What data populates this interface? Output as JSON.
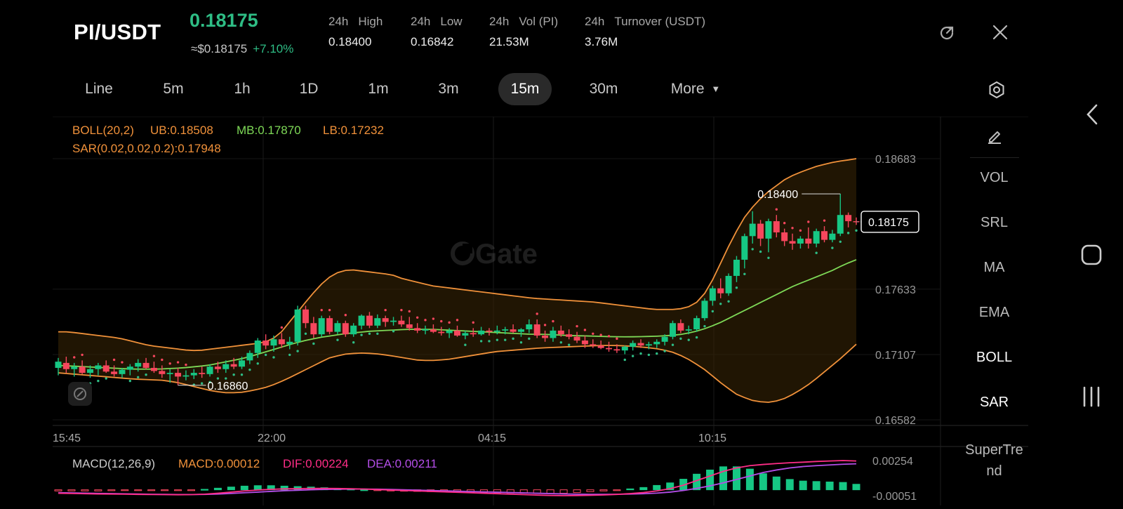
{
  "header": {
    "pair": "PI/USDT",
    "last_price": "0.18175",
    "approx_price": "≈$0.18175",
    "change": "+7.10%",
    "stats": [
      {
        "prefix": "24h",
        "label": "High",
        "value": "0.18400"
      },
      {
        "prefix": "24h",
        "label": "Low",
        "value": "0.16842"
      },
      {
        "prefix": "24h",
        "label": "Vol (PI)",
        "value": "21.53M"
      },
      {
        "prefix": "24h",
        "label": "Turnover (USDT)",
        "value": "3.76M"
      }
    ]
  },
  "timeframes": {
    "items": [
      "Line",
      "5m",
      "1h",
      "1D",
      "1m",
      "3m",
      "15m",
      "30m",
      "More"
    ],
    "active": "15m"
  },
  "indicators": {
    "boll": {
      "name": "BOLL(20,2)",
      "ub": "UB:0.18508",
      "mb": "MB:0.17870",
      "lb": "LB:0.17232"
    },
    "sar": {
      "text": "SAR(0.02,0.02,0.2):0.17948"
    },
    "macd": {
      "name": "MACD(12,26,9)",
      "macd": "MACD:0.00012",
      "dif": "DIF:0.00224",
      "dea": "DEA:0.00211"
    }
  },
  "side_panel": {
    "items": [
      "VOL",
      "SRL",
      "MA",
      "EMA",
      "BOLL",
      "SAR",
      "SuperTre",
      "nd"
    ],
    "active": [
      "BOLL",
      "SAR"
    ]
  },
  "chart_data": {
    "type": "candlestick",
    "y_ticks": [
      "0.18683",
      "0.17633",
      "0.17107",
      "0.16582"
    ],
    "x_ticks": [
      "15:45",
      "22:00",
      "04:15",
      "10:15"
    ],
    "current_price_label": "0.18175",
    "high_marker": "0.18400",
    "low_marker": "0.16860",
    "macd_ticks": [
      "0.00254",
      "-0.00051"
    ],
    "watermark": "Gate",
    "colors": {
      "up": "#16c784",
      "down": "#f6465d",
      "boll_band": "#f0913a",
      "boll_mid": "#7ed957",
      "dif": "#ff2d87",
      "dea": "#b44ee8",
      "sar_up": "#2ebd85",
      "sar_down": "#f6465d"
    },
    "candles": [
      {
        "o": 0.17,
        "h": 0.1708,
        "l": 0.1694,
        "c": 0.1705
      },
      {
        "o": 0.1704,
        "h": 0.1709,
        "l": 0.1696,
        "c": 0.1699
      },
      {
        "o": 0.1699,
        "h": 0.1704,
        "l": 0.1693,
        "c": 0.1701
      },
      {
        "o": 0.1701,
        "h": 0.1706,
        "l": 0.1695,
        "c": 0.1696
      },
      {
        "o": 0.1696,
        "h": 0.1702,
        "l": 0.1692,
        "c": 0.1699
      },
      {
        "o": 0.1699,
        "h": 0.1704,
        "l": 0.1694,
        "c": 0.1702
      },
      {
        "o": 0.1702,
        "h": 0.1706,
        "l": 0.1696,
        "c": 0.1697
      },
      {
        "o": 0.1697,
        "h": 0.1702,
        "l": 0.1693,
        "c": 0.1695
      },
      {
        "o": 0.1695,
        "h": 0.17,
        "l": 0.1692,
        "c": 0.16985
      },
      {
        "o": 0.16985,
        "h": 0.1703,
        "l": 0.1694,
        "c": 0.1701
      },
      {
        "o": 0.1701,
        "h": 0.1707,
        "l": 0.1697,
        "c": 0.1704
      },
      {
        "o": 0.1704,
        "h": 0.1708,
        "l": 0.1699,
        "c": 0.17
      },
      {
        "o": 0.17,
        "h": 0.1705,
        "l": 0.1696,
        "c": 0.16975
      },
      {
        "o": 0.16975,
        "h": 0.1702,
        "l": 0.1692,
        "c": 0.1695
      },
      {
        "o": 0.1695,
        "h": 0.1699,
        "l": 0.1688,
        "c": 0.1696
      },
      {
        "o": 0.1696,
        "h": 0.17,
        "l": 0.1686,
        "c": 0.1693
      },
      {
        "o": 0.1693,
        "h": 0.1698,
        "l": 0.169,
        "c": 0.1694
      },
      {
        "o": 0.1694,
        "h": 0.1699,
        "l": 0.1691,
        "c": 0.1696
      },
      {
        "o": 0.1696,
        "h": 0.1701,
        "l": 0.1692,
        "c": 0.1695
      },
      {
        "o": 0.1695,
        "h": 0.1703,
        "l": 0.1693,
        "c": 0.1701
      },
      {
        "o": 0.1701,
        "h": 0.1705,
        "l": 0.1696,
        "c": 0.1699
      },
      {
        "o": 0.1699,
        "h": 0.1706,
        "l": 0.1696,
        "c": 0.1703
      },
      {
        "o": 0.1703,
        "h": 0.1708,
        "l": 0.1699,
        "c": 0.1701
      },
      {
        "o": 0.1701,
        "h": 0.1709,
        "l": 0.1699,
        "c": 0.1706
      },
      {
        "o": 0.1706,
        "h": 0.1714,
        "l": 0.1703,
        "c": 0.1712
      },
      {
        "o": 0.1712,
        "h": 0.1724,
        "l": 0.1708,
        "c": 0.1722
      },
      {
        "o": 0.1722,
        "h": 0.1727,
        "l": 0.1715,
        "c": 0.1718
      },
      {
        "o": 0.1718,
        "h": 0.1726,
        "l": 0.1713,
        "c": 0.1723
      },
      {
        "o": 0.1723,
        "h": 0.1728,
        "l": 0.1716,
        "c": 0.1719
      },
      {
        "o": 0.1719,
        "h": 0.1725,
        "l": 0.1715,
        "c": 0.1721
      },
      {
        "o": 0.1721,
        "h": 0.175,
        "l": 0.1718,
        "c": 0.1747
      },
      {
        "o": 0.1747,
        "h": 0.175,
        "l": 0.1732,
        "c": 0.1736
      },
      {
        "o": 0.1736,
        "h": 0.1741,
        "l": 0.1724,
        "c": 0.1727
      },
      {
        "o": 0.1727,
        "h": 0.1742,
        "l": 0.1725,
        "c": 0.174
      },
      {
        "o": 0.174,
        "h": 0.1742,
        "l": 0.1727,
        "c": 0.1729
      },
      {
        "o": 0.1729,
        "h": 0.1738,
        "l": 0.1727,
        "c": 0.1736
      },
      {
        "o": 0.1736,
        "h": 0.1738,
        "l": 0.1725,
        "c": 0.1727
      },
      {
        "o": 0.1727,
        "h": 0.1736,
        "l": 0.1725,
        "c": 0.1734
      },
      {
        "o": 0.1734,
        "h": 0.1743,
        "l": 0.1731,
        "c": 0.1742
      },
      {
        "o": 0.1742,
        "h": 0.1745,
        "l": 0.1732,
        "c": 0.1734
      },
      {
        "o": 0.1734,
        "h": 0.1743,
        "l": 0.1732,
        "c": 0.174
      },
      {
        "o": 0.174,
        "h": 0.1742,
        "l": 0.1733,
        "c": 0.1737
      },
      {
        "o": 0.1737,
        "h": 0.1741,
        "l": 0.1734,
        "c": 0.1738
      },
      {
        "o": 0.1738,
        "h": 0.1742,
        "l": 0.1733,
        "c": 0.1735
      },
      {
        "o": 0.1735,
        "h": 0.1741,
        "l": 0.173,
        "c": 0.1732
      },
      {
        "o": 0.1732,
        "h": 0.1736,
        "l": 0.1728,
        "c": 0.173
      },
      {
        "o": 0.173,
        "h": 0.1734,
        "l": 0.1727,
        "c": 0.1731
      },
      {
        "o": 0.1731,
        "h": 0.1735,
        "l": 0.1728,
        "c": 0.1729
      },
      {
        "o": 0.1729,
        "h": 0.1733,
        "l": 0.1726,
        "c": 0.1728
      },
      {
        "o": 0.1728,
        "h": 0.1732,
        "l": 0.1724,
        "c": 0.173
      },
      {
        "o": 0.173,
        "h": 0.1734,
        "l": 0.1725,
        "c": 0.1726
      },
      {
        "o": 0.1726,
        "h": 0.173,
        "l": 0.1723,
        "c": 0.1728
      },
      {
        "o": 0.1728,
        "h": 0.1732,
        "l": 0.1725,
        "c": 0.1727
      },
      {
        "o": 0.1727,
        "h": 0.1733,
        "l": 0.1726,
        "c": 0.173
      },
      {
        "o": 0.173,
        "h": 0.1732,
        "l": 0.1726,
        "c": 0.1729
      },
      {
        "o": 0.1729,
        "h": 0.1734,
        "l": 0.1727,
        "c": 0.173
      },
      {
        "o": 0.173,
        "h": 0.1733,
        "l": 0.1727,
        "c": 0.1731
      },
      {
        "o": 0.1731,
        "h": 0.1735,
        "l": 0.1728,
        "c": 0.1729
      },
      {
        "o": 0.1729,
        "h": 0.1732,
        "l": 0.1725,
        "c": 0.1731
      },
      {
        "o": 0.1731,
        "h": 0.1739,
        "l": 0.1728,
        "c": 0.1735
      },
      {
        "o": 0.1735,
        "h": 0.1739,
        "l": 0.1724,
        "c": 0.1726
      },
      {
        "o": 0.1726,
        "h": 0.173,
        "l": 0.1721,
        "c": 0.1724
      },
      {
        "o": 0.1724,
        "h": 0.1733,
        "l": 0.1721,
        "c": 0.173
      },
      {
        "o": 0.173,
        "h": 0.1734,
        "l": 0.1725,
        "c": 0.1727
      },
      {
        "o": 0.1727,
        "h": 0.1731,
        "l": 0.1723,
        "c": 0.1725
      },
      {
        "o": 0.1725,
        "h": 0.1729,
        "l": 0.172,
        "c": 0.1722
      },
      {
        "o": 0.1722,
        "h": 0.1726,
        "l": 0.1716,
        "c": 0.1719
      },
      {
        "o": 0.1719,
        "h": 0.1723,
        "l": 0.1716,
        "c": 0.1718
      },
      {
        "o": 0.1718,
        "h": 0.1722,
        "l": 0.1715,
        "c": 0.1716
      },
      {
        "o": 0.1716,
        "h": 0.1721,
        "l": 0.1713,
        "c": 0.1715
      },
      {
        "o": 0.1715,
        "h": 0.1719,
        "l": 0.1712,
        "c": 0.1714
      },
      {
        "o": 0.1714,
        "h": 0.1718,
        "l": 0.1711,
        "c": 0.1717
      },
      {
        "o": 0.1717,
        "h": 0.1722,
        "l": 0.1714,
        "c": 0.172
      },
      {
        "o": 0.172,
        "h": 0.1723,
        "l": 0.1716,
        "c": 0.1718
      },
      {
        "o": 0.1718,
        "h": 0.1721,
        "l": 0.1715,
        "c": 0.1719
      },
      {
        "o": 0.1719,
        "h": 0.1723,
        "l": 0.1716,
        "c": 0.1721
      },
      {
        "o": 0.1721,
        "h": 0.1727,
        "l": 0.1718,
        "c": 0.1725
      },
      {
        "o": 0.1725,
        "h": 0.1738,
        "l": 0.1723,
        "c": 0.1736
      },
      {
        "o": 0.1736,
        "h": 0.1739,
        "l": 0.1728,
        "c": 0.173
      },
      {
        "o": 0.173,
        "h": 0.1734,
        "l": 0.1727,
        "c": 0.1731
      },
      {
        "o": 0.1731,
        "h": 0.1742,
        "l": 0.1729,
        "c": 0.174
      },
      {
        "o": 0.174,
        "h": 0.1756,
        "l": 0.1738,
        "c": 0.1754
      },
      {
        "o": 0.1754,
        "h": 0.1766,
        "l": 0.175,
        "c": 0.1764
      },
      {
        "o": 0.1764,
        "h": 0.1772,
        "l": 0.1756,
        "c": 0.176
      },
      {
        "o": 0.176,
        "h": 0.1776,
        "l": 0.1758,
        "c": 0.1774
      },
      {
        "o": 0.1774,
        "h": 0.179,
        "l": 0.1769,
        "c": 0.1787
      },
      {
        "o": 0.1787,
        "h": 0.1808,
        "l": 0.178,
        "c": 0.1806
      },
      {
        "o": 0.1806,
        "h": 0.1826,
        "l": 0.18,
        "c": 0.1816
      },
      {
        "o": 0.1816,
        "h": 0.1819,
        "l": 0.1798,
        "c": 0.1804
      },
      {
        "o": 0.1804,
        "h": 0.182,
        "l": 0.1793,
        "c": 0.1818
      },
      {
        "o": 0.1818,
        "h": 0.1823,
        "l": 0.1805,
        "c": 0.1809
      },
      {
        "o": 0.1809,
        "h": 0.1812,
        "l": 0.1798,
        "c": 0.1802
      },
      {
        "o": 0.1802,
        "h": 0.1808,
        "l": 0.1795,
        "c": 0.18
      },
      {
        "o": 0.18,
        "h": 0.1806,
        "l": 0.1796,
        "c": 0.1804
      },
      {
        "o": 0.1804,
        "h": 0.1813,
        "l": 0.1796,
        "c": 0.18
      },
      {
        "o": 0.18,
        "h": 0.1812,
        "l": 0.1797,
        "c": 0.181
      },
      {
        "o": 0.181,
        "h": 0.1814,
        "l": 0.1801,
        "c": 0.1803
      },
      {
        "o": 0.1803,
        "h": 0.1811,
        "l": 0.1801,
        "c": 0.1808
      },
      {
        "o": 0.1808,
        "h": 0.184,
        "l": 0.1806,
        "c": 0.1823
      },
      {
        "o": 0.1823,
        "h": 0.1825,
        "l": 0.1813,
        "c": 0.1818
      },
      {
        "o": 0.1818,
        "h": 0.1821,
        "l": 0.1815,
        "c": 0.18175
      }
    ],
    "boll_ub": [
      0.1729,
      0.1729,
      0.1728,
      0.1727,
      0.1726,
      0.1725,
      0.1724,
      0.1722,
      0.172,
      0.1718,
      0.1717,
      0.1716,
      0.1715,
      0.1714,
      0.1714,
      0.1715,
      0.1716,
      0.1717,
      0.1718,
      0.1719,
      0.172,
      0.1722,
      0.1728,
      0.1738,
      0.1748,
      0.1758,
      0.1767,
      0.1774,
      0.1778,
      0.1779,
      0.1778,
      0.1777,
      0.1776,
      0.1775,
      0.1772,
      0.177,
      0.1768,
      0.1766,
      0.1765,
      0.1764,
      0.1763,
      0.1762,
      0.1761,
      0.176,
      0.1759,
      0.1758,
      0.1757,
      0.1756,
      0.17555,
      0.1755,
      0.17545,
      0.1754,
      0.17535,
      0.1753,
      0.1752,
      0.1751,
      0.175,
      0.1749,
      0.1748,
      0.1747,
      0.1747,
      0.1747,
      0.1748,
      0.1751,
      0.176,
      0.1774,
      0.1792,
      0.1808,
      0.1822,
      0.1832,
      0.184,
      0.1846,
      0.1852,
      0.1856,
      0.1859,
      0.1862,
      0.1864,
      0.1866,
      0.1867,
      0.18683
    ],
    "boll_mb": [
      0.1702,
      0.17015,
      0.1701,
      0.17005,
      0.17,
      0.16995,
      0.1699,
      0.1699,
      0.1699,
      0.16995,
      0.17,
      0.1701,
      0.1702,
      0.1704,
      0.1706,
      0.1708,
      0.1711,
      0.1714,
      0.1717,
      0.172,
      0.17225,
      0.17245,
      0.1726,
      0.17275,
      0.17285,
      0.17295,
      0.173,
      0.17305,
      0.1731,
      0.1731,
      0.1731,
      0.17305,
      0.173,
      0.17295,
      0.1729,
      0.17285,
      0.1728,
      0.17275,
      0.1727,
      0.1727,
      0.17265,
      0.1726,
      0.17258,
      0.17255,
      0.17252,
      0.1725,
      0.1725,
      0.17252,
      0.17255,
      0.1726,
      0.1727,
      0.1729,
      0.1732,
      0.1736,
      0.1741,
      0.1746,
      0.1751,
      0.1756,
      0.1761,
      0.1766,
      0.177,
      0.1774,
      0.1778,
      0.1783,
      0.1787
    ],
    "boll_lb": [
      0.1696,
      0.1695,
      0.1694,
      0.1693,
      0.1692,
      0.1691,
      0.16905,
      0.169,
      0.1688,
      0.1685,
      0.1682,
      0.168,
      0.168,
      0.1682,
      0.1685,
      0.169,
      0.1696,
      0.1702,
      0.1708,
      0.1711,
      0.1712,
      0.17115,
      0.171,
      0.1708,
      0.1706,
      0.1706,
      0.1707,
      0.1709,
      0.1711,
      0.1713,
      0.1714,
      0.1715,
      0.1716,
      0.17165,
      0.1717,
      0.17175,
      0.1718,
      0.1718,
      0.17175,
      0.17165,
      0.1715,
      0.1712,
      0.1706,
      0.1698,
      0.1688,
      0.1679,
      0.1674,
      0.1672,
      0.1674,
      0.168,
      0.1688,
      0.1698,
      0.1708,
      0.1719
    ],
    "sar": [],
    "macd_dif": [
      -0.0003,
      -0.00032,
      -0.00034,
      -0.00036,
      -0.00037,
      -0.00038,
      -0.0004,
      -0.00041,
      -0.00042,
      -0.00043,
      -0.00042,
      -0.00038,
      -0.0003,
      -0.0002,
      -0.0001,
      -2e-05,
      4e-05,
      8e-05,
      0.0001,
      0.00012,
      0.00012,
      0.00011,
      9e-05,
      6e-05,
      2e-05,
      -2e-05,
      -6e-05,
      -0.0001,
      -0.00014,
      -0.00018,
      -0.00022,
      -0.00026,
      -0.0003,
      -0.00034,
      -0.00038,
      -0.00042,
      -0.00046,
      -0.00049,
      -0.00051,
      -0.0005,
      -0.00048,
      -0.00045,
      -0.0004,
      -0.00033,
      -0.00024,
      -0.0001,
      0.0001,
      0.0004,
      0.0008,
      0.0012,
      0.0016,
      0.0019,
      0.0021,
      0.0022,
      0.00228,
      0.00235,
      0.0024,
      0.00246,
      0.0025,
      0.00254,
      0.0025
    ],
    "macd_dea": [
      -0.00025,
      -0.00027,
      -0.00029,
      -0.00031,
      -0.00033,
      -0.00035,
      -0.00037,
      -0.00039,
      -0.0004,
      -0.00041,
      -0.00041,
      -0.0004,
      -0.00037,
      -0.00032,
      -0.00026,
      -0.0002,
      -0.00014,
      -8e-05,
      -4e-05,
      0.0,
      3e-05,
      5e-05,
      6e-05,
      6e-05,
      5e-05,
      3e-05,
      0.0,
      -3e-05,
      -6e-05,
      -9e-05,
      -0.00012,
      -0.00015,
      -0.00018,
      -0.00021,
      -0.00024,
      -0.00027,
      -0.0003,
      -0.00033,
      -0.00036,
      -0.00038,
      -0.0004,
      -0.0004,
      -0.00039,
      -0.00037,
      -0.00034,
      -0.00029,
      -0.0002,
      -6e-05,
      0.00012,
      0.00034,
      0.0006,
      0.0009,
      0.0012,
      0.0015,
      0.00172,
      0.0019,
      0.00202,
      0.0021,
      0.00216,
      0.00222,
      0.00226
    ]
  }
}
